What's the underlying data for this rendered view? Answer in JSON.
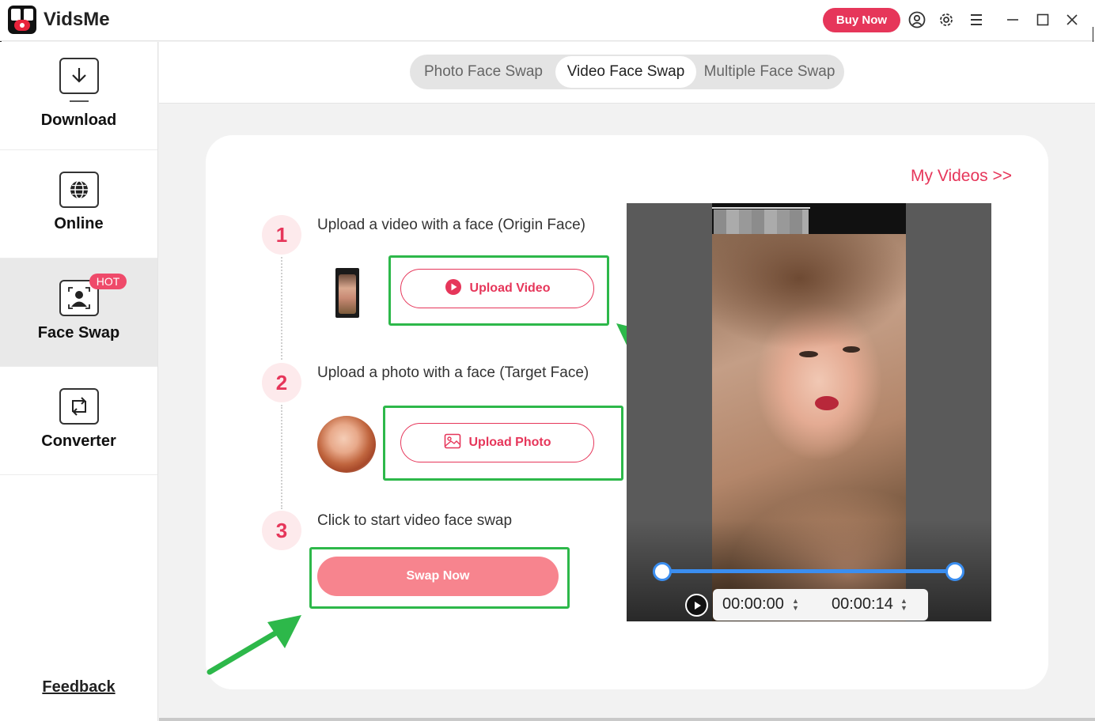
{
  "app": {
    "title": "VidsMe",
    "buy_now": "Buy Now"
  },
  "colors": {
    "accent": "#e6365a",
    "highlight_green": "#2db84a",
    "range_blue": "#3b8ef0"
  },
  "titlebar_icons": [
    "user-circle-icon",
    "gear-icon",
    "menu-icon",
    "minimize-icon",
    "maximize-icon",
    "close-icon"
  ],
  "sidebar": {
    "items": [
      {
        "label": "Download",
        "icon": "download-icon"
      },
      {
        "label": "Online",
        "icon": "globe-icon"
      },
      {
        "label": "Face Swap",
        "icon": "face-swap-icon",
        "badge": "HOT",
        "active": true
      },
      {
        "label": "Converter",
        "icon": "converter-icon"
      }
    ],
    "feedback": "Feedback"
  },
  "tabs": [
    {
      "label": "Photo Face Swap"
    },
    {
      "label": "Video Face Swap",
      "active": true
    },
    {
      "label": "Multiple Face Swap"
    }
  ],
  "main": {
    "my_videos": "My Videos >>",
    "steps": [
      {
        "num": "1",
        "text": "Upload a video with a face  (Origin Face)",
        "button": "Upload Video"
      },
      {
        "num": "2",
        "text": "Upload a photo with a face  (Target Face)",
        "button": "Upload Photo"
      },
      {
        "num": "3",
        "text": "Click to start video face swap",
        "button": "Swap Now"
      }
    ]
  },
  "preview": {
    "start_time": "00:00:00",
    "end_time": "00:00:14"
  }
}
